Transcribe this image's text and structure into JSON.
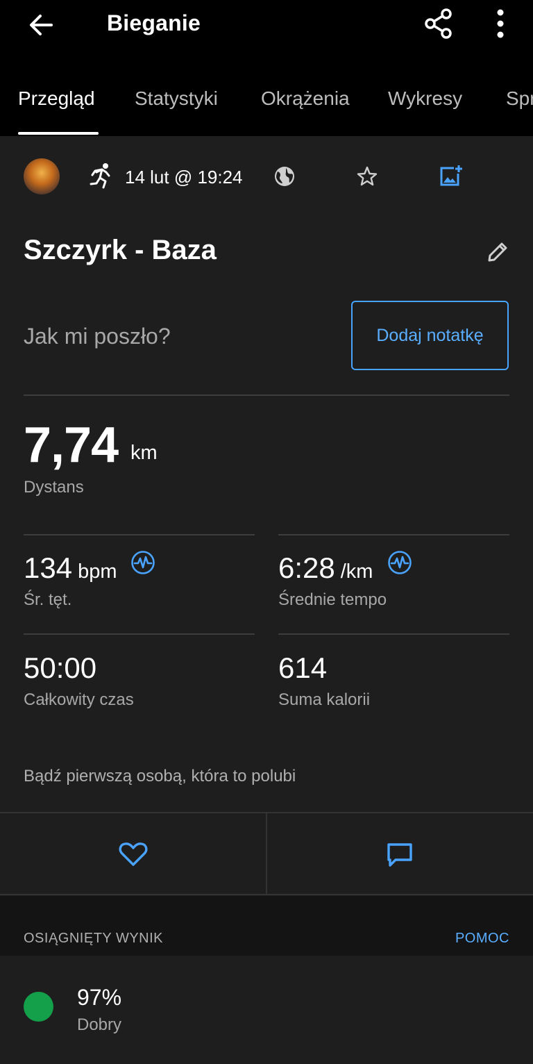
{
  "header": {
    "title": "Bieganie"
  },
  "tabs": [
    {
      "label": "Przegląd"
    },
    {
      "label": "Statystyki"
    },
    {
      "label": "Okrążenia"
    },
    {
      "label": "Wykresy"
    },
    {
      "label": "Spr"
    }
  ],
  "activity": {
    "datetime": "14 lut @ 19:24",
    "name": "Szczyrk - Baza",
    "note_prompt": "Jak mi poszło?",
    "note_button": "Dodaj notatkę"
  },
  "distance": {
    "value": "7,74",
    "unit": "km",
    "label": "Dystans"
  },
  "stats": {
    "hr": {
      "value": "134",
      "unit": "bpm",
      "label": "Śr. tęt."
    },
    "pace": {
      "value": "6:28",
      "unit": "/km",
      "label": "Średnie tempo"
    },
    "time": {
      "value": "50:00",
      "label": "Całkowity czas"
    },
    "calories": {
      "value": "614",
      "label": "Suma kalorii"
    }
  },
  "social": {
    "likes_text": "Bądź pierwszą osobą, która to polubi"
  },
  "score_section": {
    "title": "OSIĄGNIĘTY WYNIK",
    "help": "POMOC",
    "value": "97%",
    "label": "Dobry"
  },
  "colors": {
    "accent": "#5aaeff",
    "good": "#14a04a",
    "background": "#1e1e1e",
    "header": "#000000"
  },
  "icons": [
    "back-arrow-icon",
    "share-icon",
    "more-vert-icon",
    "running-icon",
    "globe-icon",
    "star-icon",
    "add-photo-icon",
    "edit-pencil-icon",
    "heart-rate-icon",
    "heart-icon",
    "comment-icon"
  ]
}
